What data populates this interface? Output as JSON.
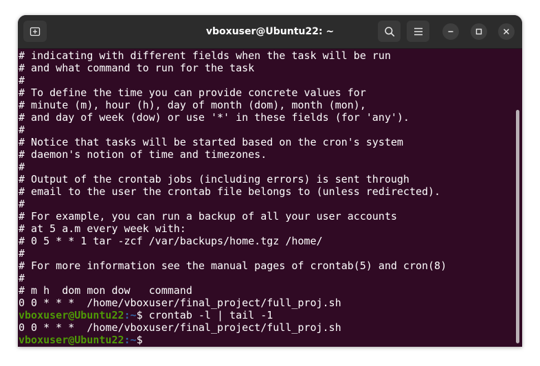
{
  "window": {
    "title": "vboxuser@Ubuntu22: ~"
  },
  "titlebar": {
    "new_tab_icon": "new-tab-icon",
    "search_icon": "search-icon",
    "menu_icon": "hamburger-menu-icon",
    "minimize_icon": "minimize-icon",
    "maximize_icon": "maximize-icon",
    "close_icon": "close-icon"
  },
  "colors": {
    "terminal_bg": "#300a24",
    "titlebar_bg": "#2c2c2c",
    "prompt_user": "#4e9a06",
    "prompt_path": "#3465a4",
    "text": "#ffffff"
  },
  "terminal": {
    "lines": [
      "# indicating with different fields when the task will be run",
      "# and what command to run for the task",
      "#",
      "# To define the time you can provide concrete values for",
      "# minute (m), hour (h), day of month (dom), month (mon),",
      "# and day of week (dow) or use '*' in these fields (for 'any').",
      "#",
      "# Notice that tasks will be started based on the cron's system",
      "# daemon's notion of time and timezones.",
      "#",
      "# Output of the crontab jobs (including errors) is sent through",
      "# email to the user the crontab file belongs to (unless redirected).",
      "#",
      "# For example, you can run a backup of all your user accounts",
      "# at 5 a.m every week with:",
      "# 0 5 * * 1 tar -zcf /var/backups/home.tgz /home/",
      "#",
      "# For more information see the manual pages of crontab(5) and cron(8)",
      "#",
      "# m h  dom mon dow   command",
      "0 0 * * *  /home/vboxuser/final_project/full_proj.sh"
    ],
    "prompt1": {
      "user": "vboxuser@Ubuntu22",
      "path": ":~",
      "symbol": "$ ",
      "command": "crontab -l | tail -1"
    },
    "output_line": "0 0 * * *  /home/vboxuser/final_project/full_proj.sh",
    "prompt2": {
      "user": "vboxuser@Ubuntu22",
      "path": ":~",
      "symbol": "$"
    }
  }
}
